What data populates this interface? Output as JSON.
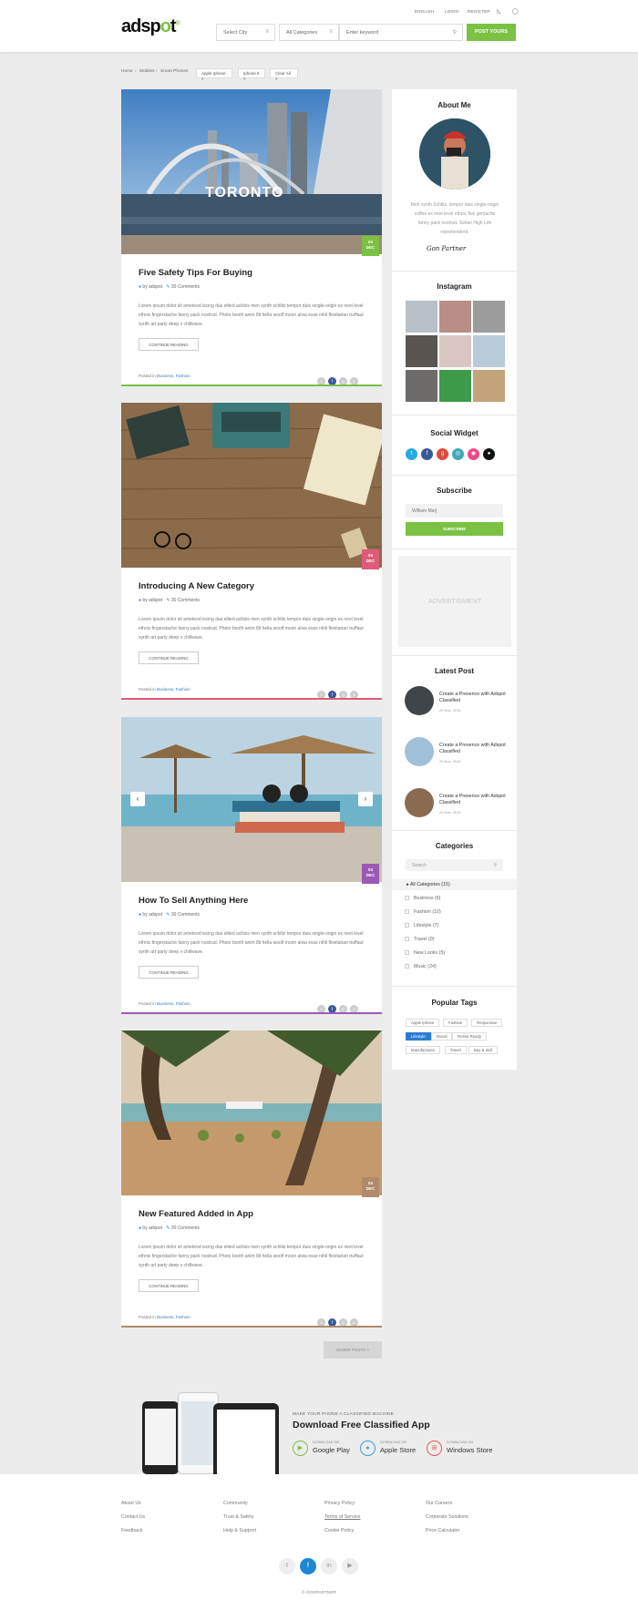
{
  "header": {
    "logo_main": "adsp",
    "logo_accent": "o",
    "logo_tail": "t",
    "logo_mark": "®",
    "top_links": [
      "ENGLISH",
      "LOGIN",
      "REGISTER"
    ],
    "city_placeholder": "Select City",
    "category_select": "All Categories",
    "keyword_placeholder": "Enter keyword",
    "post_button": "POST YOURS"
  },
  "breadcrumb": {
    "items": [
      "Home",
      "Mobiles",
      "Smart Phones"
    ],
    "filters": [
      "Apple Iphone",
      "Iphone 6",
      "Clear All"
    ]
  },
  "posts": [
    {
      "title": "Five Safety Tips For Buying",
      "author": "by adspot",
      "comments": "30 Comments",
      "date_day": "04",
      "date_mon": "DEC",
      "color": "#7bc143",
      "excerpt": "Lorem ipsum dolor sit ameteod iscing das elited acilisis men synth schlitz tempor duis single-origin ex next level ethnic fingerstache fanny pack nostrud. Photo booth anim 8it hella woolf moon alvia esse nihil flexitarian truffaut synth art party deep v chillwave.",
      "more": "CONTINUE READING",
      "posted_label": "Posted in",
      "posted_tags": "Business, Fashion"
    },
    {
      "title": "Introducing A New Category",
      "author": "by adspot",
      "comments": "30 Comments",
      "date_day": "04",
      "date_mon": "DEC",
      "color": "#e05a7a",
      "excerpt": "Lorem ipsum dolor sit ameteod iscing das elited acilisis men synth schlitz tempor duis single-origin ex next level ethnic fingerstache fanny pack nostrud. Photo booth anim 8it hella woolf moon alvia esse nihil flexitarian truffaut synth art party deep v chillwave.",
      "more": "CONTINUE READING",
      "posted_label": "Posted in",
      "posted_tags": "Business, Fashion"
    },
    {
      "title": "How To Sell Anything Here",
      "author": "by adspot",
      "comments": "30 Comments",
      "date_day": "04",
      "date_mon": "DEC",
      "color": "#9b59b6",
      "excerpt": "Lorem ipsum dolor sit ameteod iscing das elited acilisis men synth schlitz tempor duis single-origin ex next level ethnic fingerstache fanny pack nostrud. Photo booth anim 8it hella woolf moon alvia esse nihil flexitarian truffaut synth art party deep v chillwave.",
      "more": "CONTINUE READING",
      "posted_label": "Posted in",
      "posted_tags": "Business, Fashion"
    },
    {
      "title": "New Featured Added in App",
      "author": "by adspot",
      "comments": "30 Comments",
      "date_day": "04",
      "date_mon": "DEC",
      "color": "#b08a6a",
      "excerpt": "Lorem ipsum dolor sit ameteod iscing das elited acilisis men synth schlitz tempor duis single-origin ex next level ethnic fingerstache fanny pack nostrud. Photo booth anim 8it hella woolf moon alvia esse nihil flexitarian truffaut synth art party deep v chillwave.",
      "more": "CONTINUE READING",
      "posted_label": "Posted in",
      "posted_tags": "Business, Fashion"
    }
  ],
  "older_posts": "OLDER POSTS >",
  "sidebar": {
    "about_title": "About Me",
    "about_text": "Meh synth Schlitz, tempor duis single-origin coffee ex next level ethnic five gentache fanny pack nostrud. Seitan High Life reprehenderit.",
    "signature": "Gon Partner",
    "instagram_title": "Instagram",
    "social_title": "Social Widget",
    "subscribe_title": "Subscribe",
    "subscribe_value": "William Marj",
    "subscribe_button": "SUBSCRIBE",
    "ad_text": "ADVERTISMENT",
    "latest_title": "Latest Post",
    "latest": [
      {
        "title": "Create a Presence with Adspot Classified",
        "date": "20 Nov, 2015"
      },
      {
        "title": "Create a Presence with Adspot Classified",
        "date": "20 Nov, 2015"
      },
      {
        "title": "Create a Presence with Adspot Classified",
        "date": "20 Nov, 2015"
      }
    ],
    "categories_title": "Categories",
    "search_placeholder": "Search",
    "categories": [
      "All Categories  (15)",
      "Business  (6)",
      "Fashion  (10)",
      "Lifestyle  (7)",
      "Travel  (0)",
      "New Looks  (5)",
      "Music  (24)"
    ],
    "tags_title": "Popular Tags",
    "tags": [
      "Apple Iphone",
      "Fashion",
      "Responsive",
      "Lifestyle",
      "Brand",
      "Retina Ready",
      "Manufactures",
      "Travel",
      "Buy & Sell"
    ]
  },
  "app_promo": {
    "kicker": "MAKE YOUR PHONE A CLASSIFIED MACHINE",
    "title": "Download Free Classified App",
    "stores": [
      {
        "small": "DOWNLOAD ON",
        "name": "Google Play",
        "color": "#7bc143"
      },
      {
        "small": "DOWNLOAD ON",
        "name": "Apple Store",
        "color": "#3b9fd8"
      },
      {
        "small": "DOWNLOAD ON",
        "name": "Windows Store",
        "color": "#e05a5a"
      }
    ]
  },
  "footer": {
    "columns": [
      [
        "About Us",
        "Contact Us",
        "Feedback"
      ],
      [
        "Community",
        "Trust & Safety",
        "Help & Support"
      ],
      [
        "Privacy Policy",
        "Terms of Service",
        "Cookie Policy"
      ],
      [
        "Our Careers",
        "Corporate Solutions",
        "Price Calculator"
      ]
    ],
    "copyright": "© GOXPARTNER"
  }
}
